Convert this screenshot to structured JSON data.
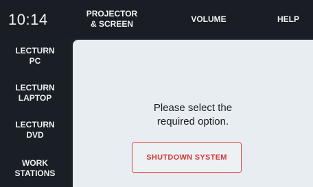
{
  "header": {
    "time": "10:14",
    "projector_label": "PROJECTOR\n& SCREEN",
    "volume_label": "VOLUME",
    "help_label": "HELP"
  },
  "sidebar": {
    "items": [
      {
        "label": "LECTURN\nPC"
      },
      {
        "label": "LECTURN\nLAPTOP"
      },
      {
        "label": "LECTURN\nDVD"
      },
      {
        "label": "WORK\nSTATIONS"
      }
    ]
  },
  "main": {
    "prompt": "Please select the\nrequired option.",
    "shutdown_label": "SHUTDOWN SYSTEM"
  },
  "colors": {
    "background": "#1c2128",
    "panel": "#e8edf2",
    "accent_red": "#d23a36"
  }
}
